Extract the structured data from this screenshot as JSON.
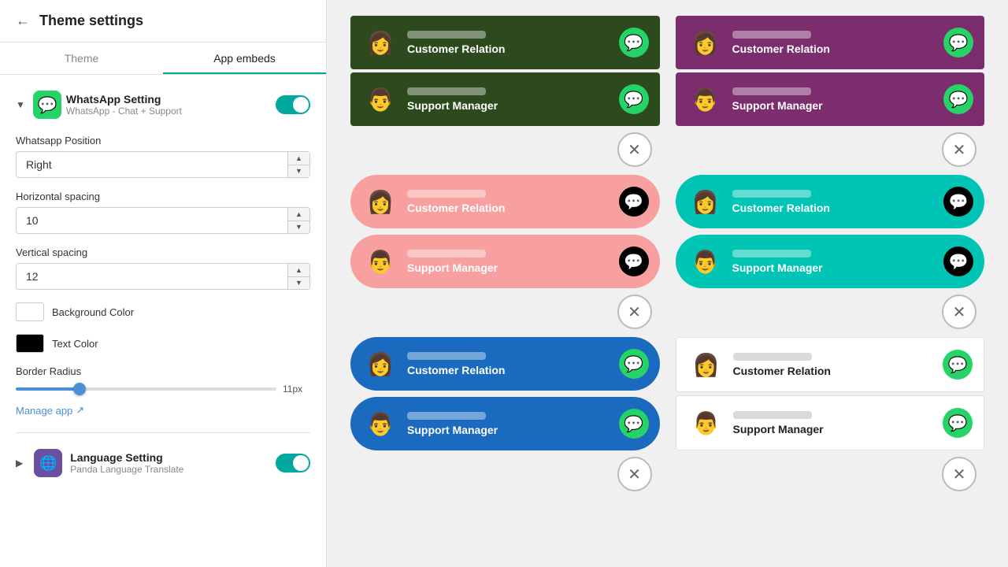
{
  "sidebar": {
    "title": "Theme settings",
    "back_label": "←",
    "tabs": [
      {
        "label": "Theme",
        "active": false
      },
      {
        "label": "App embeds",
        "active": true
      }
    ],
    "plugin": {
      "name": "WhatsApp Setting",
      "sub": "WhatsApp - Chat + Support",
      "enabled": true,
      "expand_icon": "▼"
    },
    "fields": {
      "position_label": "Whatsapp Position",
      "position_value": "Right",
      "h_spacing_label": "Horizontal spacing",
      "h_spacing_value": "10",
      "v_spacing_label": "Vertical spacing",
      "v_spacing_value": "12",
      "bg_color_label": "Background Color",
      "text_color_label": "Text Color",
      "border_radius_label": "Border Radius",
      "border_radius_value": "11px",
      "manage_link": "Manage app"
    },
    "language": {
      "name": "Language Setting",
      "sub": "Panda Language Translate",
      "enabled": true,
      "expand_icon": "▶"
    }
  },
  "previews": {
    "left": [
      {
        "style": "dark-green",
        "contacts": [
          {
            "role": "Customer Relation",
            "avatar": "👩"
          },
          {
            "role": "Support Manager",
            "avatar": "👨"
          }
        ],
        "wa_style": "green-circle"
      },
      {
        "style": "pink",
        "contacts": [
          {
            "role": "Customer Relation",
            "avatar": "👩"
          },
          {
            "role": "Support Manager",
            "avatar": "👨"
          }
        ],
        "wa_style": "black-circle"
      },
      {
        "style": "blue",
        "contacts": [
          {
            "role": "Customer Relation",
            "avatar": "👩"
          },
          {
            "role": "Support Manager",
            "avatar": "👨"
          }
        ],
        "wa_style": "green-circle"
      }
    ],
    "right": [
      {
        "style": "purple",
        "contacts": [
          {
            "role": "Customer Relation",
            "avatar": "👩"
          },
          {
            "role": "Support Manager",
            "avatar": "👨"
          }
        ],
        "wa_style": "green-circle"
      },
      {
        "style": "teal",
        "contacts": [
          {
            "role": "Customer Relation",
            "avatar": "👩"
          },
          {
            "role": "Support Manager",
            "avatar": "👨"
          }
        ],
        "wa_style": "black-circle"
      },
      {
        "style": "white",
        "contacts": [
          {
            "role": "Customer Relation",
            "avatar": "👩"
          },
          {
            "role": "Support Manager",
            "avatar": "👨"
          }
        ],
        "wa_style": "green-circle"
      }
    ],
    "close_symbol": "✕"
  }
}
